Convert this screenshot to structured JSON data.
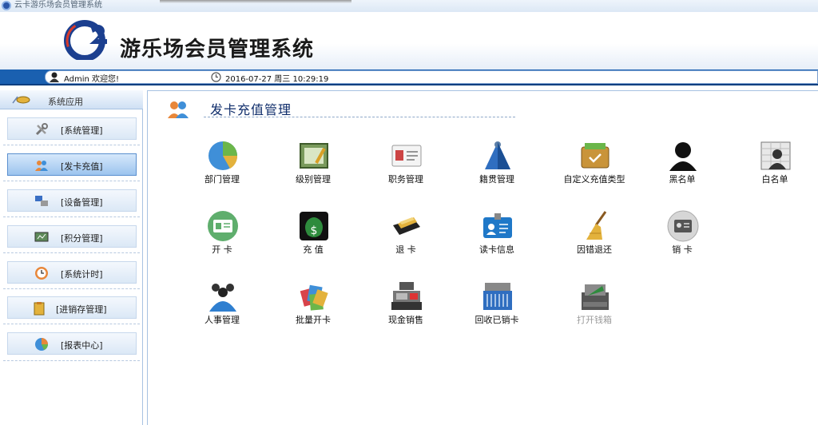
{
  "window": {
    "title": "云卡游乐场会员管理系统"
  },
  "banner": {
    "title": "游乐场会员管理系统"
  },
  "status": {
    "user": "Admin 欢迎您!",
    "datetime": "2016-07-27  周三  10:29:19"
  },
  "sidebar": {
    "header": "系统应用",
    "items": [
      {
        "label": "[系统管理]",
        "icon": "tools-icon"
      },
      {
        "label": "[发卡充值]",
        "icon": "users-icon",
        "active": true
      },
      {
        "label": "[设备管理]",
        "icon": "devices-icon"
      },
      {
        "label": "[积分管理]",
        "icon": "points-icon"
      },
      {
        "label": "[系统计时]",
        "icon": "clock-icon"
      },
      {
        "label": "[进销存管理]",
        "icon": "inventory-icon"
      },
      {
        "label": "[报表中心]",
        "icon": "report-icon"
      }
    ]
  },
  "main": {
    "title": "发卡充值管理",
    "tiles": [
      {
        "label": "部门管理",
        "icon": "department-icon"
      },
      {
        "label": "级别管理",
        "icon": "level-icon"
      },
      {
        "label": "职务管理",
        "icon": "position-icon"
      },
      {
        "label": "籍贯管理",
        "icon": "origin-icon"
      },
      {
        "label": "自定义充值类型",
        "icon": "custom-recharge-icon"
      },
      {
        "label": "黑名单",
        "icon": "blacklist-icon"
      },
      {
        "label": "白名单",
        "icon": "whitelist-icon"
      },
      {
        "label": "开 卡",
        "icon": "open-card-icon"
      },
      {
        "label": "充 值",
        "icon": "recharge-icon"
      },
      {
        "label": "退 卡",
        "icon": "return-card-icon"
      },
      {
        "label": "读卡信息",
        "icon": "read-card-icon"
      },
      {
        "label": "因错退还",
        "icon": "refund-icon"
      },
      {
        "label": "销 卡",
        "icon": "cancel-card-icon"
      },
      {
        "label": "人事管理",
        "icon": "personnel-icon"
      },
      {
        "label": "批量开卡",
        "icon": "batch-card-icon"
      },
      {
        "label": "现金销售",
        "icon": "cash-sale-icon"
      },
      {
        "label": "回收已销卡",
        "icon": "recycle-icon"
      },
      {
        "label": "打开钱箱",
        "icon": "cashbox-icon",
        "disabled": true
      }
    ]
  }
}
